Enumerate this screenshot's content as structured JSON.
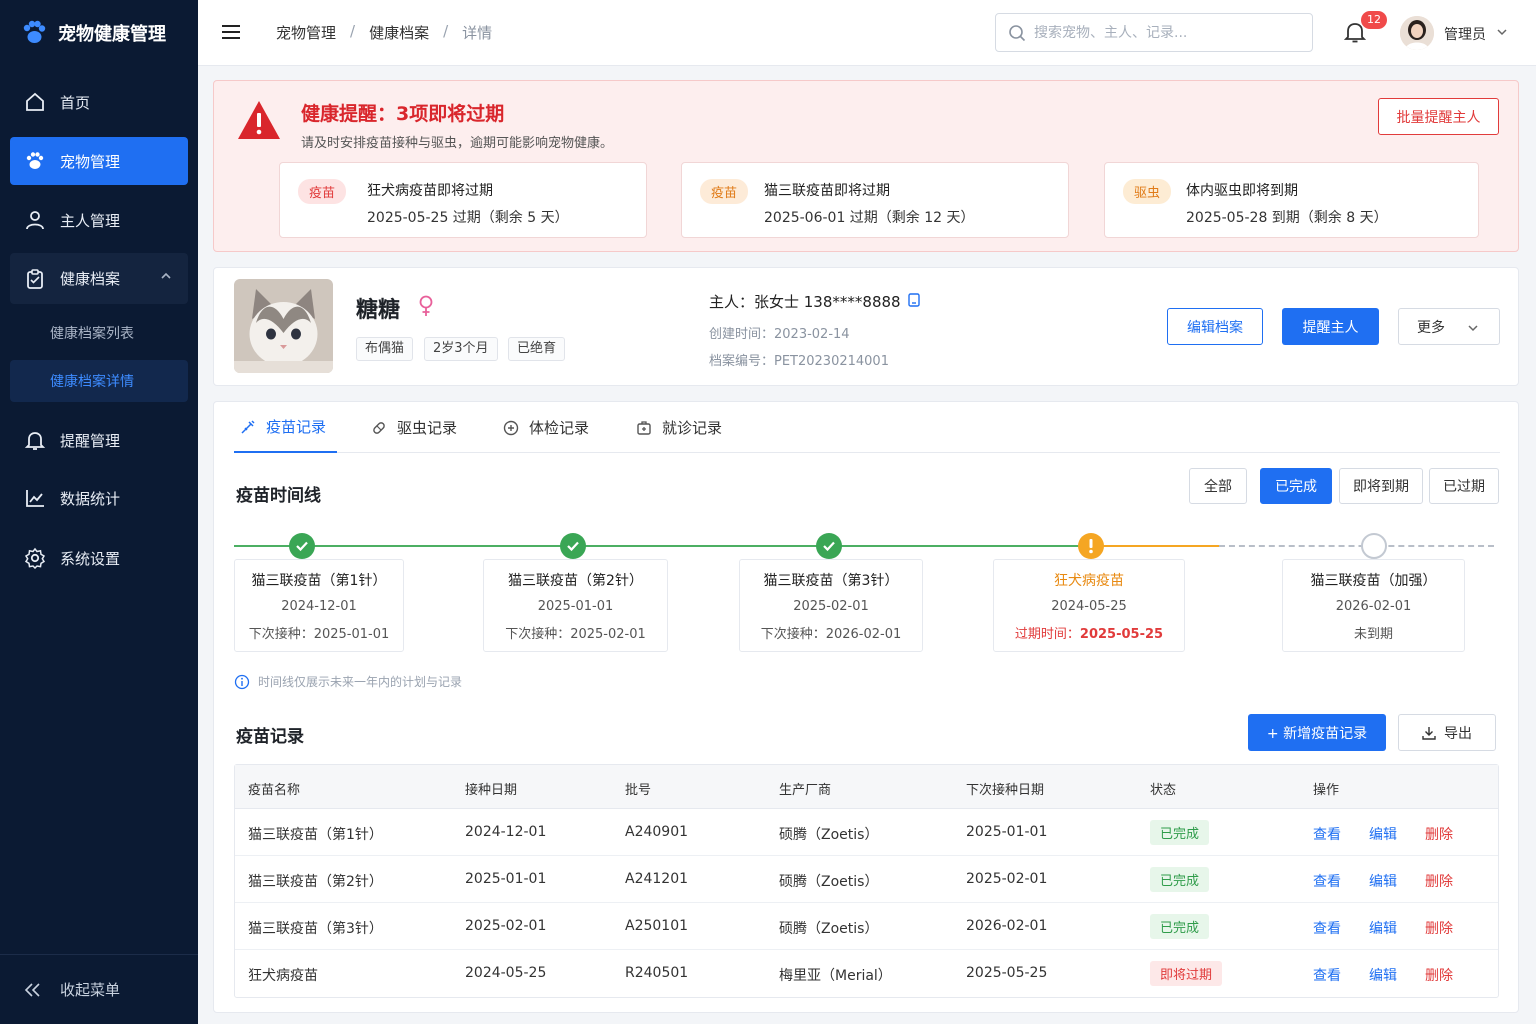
{
  "app": {
    "title": "宠物健康管理"
  },
  "sidebar": {
    "items": [
      {
        "label": "首页",
        "icon": "home-icon"
      },
      {
        "label": "宠物管理",
        "icon": "paw-icon"
      },
      {
        "label": "主人管理",
        "icon": "user-icon"
      },
      {
        "label": "健康档案",
        "icon": "clipboard-icon"
      },
      {
        "label": "提醒管理",
        "icon": "bell-icon"
      },
      {
        "label": "数据统计",
        "icon": "chart-icon"
      },
      {
        "label": "系统设置",
        "icon": "gear-icon"
      }
    ],
    "subitems": [
      {
        "label": "健康档案列表"
      },
      {
        "label": "健康档案详情"
      }
    ],
    "collapse_label": "收起菜单"
  },
  "topbar": {
    "breadcrumb": [
      "宠物管理",
      "健康档案",
      "详情"
    ],
    "search_placeholder": "搜索宠物、主人、记录...",
    "notification_count": "12",
    "user_name": "管理员"
  },
  "alert": {
    "title": "健康提醒：3项即将过期",
    "desc": "请及时安排疫苗接种与驱虫，逾期可能影响宠物健康。",
    "action": "批量提醒主人",
    "cards": [
      {
        "tag": "疫苗",
        "title": "狂犬病疫苗即将过期",
        "detail": "2025-05-25 过期（剩余 5 天）"
      },
      {
        "tag": "疫苗",
        "title": "猫三联疫苗即将过期",
        "detail": "2025-06-01 过期（剩余 12 天）"
      },
      {
        "tag": "驱虫",
        "title": "体内驱虫即将到期",
        "detail": "2025-05-28 到期（剩余 8 天）"
      }
    ]
  },
  "profile": {
    "name": "糖糖",
    "tags": [
      "布偶猫",
      "2岁3个月",
      "已绝育"
    ],
    "owner": "主人：张女士   138****8888",
    "created": "创建时间：2023-02-14",
    "record_no": "档案编号：PET20230214001",
    "buttons": {
      "edit": "编辑档案",
      "remind": "提醒主人",
      "more": "更多"
    }
  },
  "tabs": [
    "疫苗记录",
    "驱虫记录",
    "体检记录",
    "就诊记录"
  ],
  "timeline": {
    "title": "疫苗时间线",
    "filters": [
      "全部",
      "已完成",
      "即将到期",
      "已过期"
    ],
    "items": [
      {
        "name": "猫三联疫苗（第1针）",
        "date": "2024-12-01",
        "extra": "下次接种：2025-01-01"
      },
      {
        "name": "猫三联疫苗（第2针）",
        "date": "2025-01-01",
        "extra": "下次接种：2025-02-01"
      },
      {
        "name": "猫三联疫苗（第3针）",
        "date": "2025-02-01",
        "extra": "下次接种：2026-02-01"
      },
      {
        "name": "狂犬病疫苗",
        "date": "2024-05-25",
        "extra_label": "过期时间：",
        "extra_value": "2025-05-25"
      },
      {
        "name": "猫三联疫苗（加强）",
        "date": "2026-02-01",
        "extra": "未到期"
      }
    ],
    "note": "时间线仅展示未来一年内的计划与记录"
  },
  "records": {
    "title": "疫苗记录",
    "add_button": "+ 新增疫苗记录",
    "export_button": "导出",
    "columns": [
      "疫苗名称",
      "接种日期",
      "批号",
      "生产厂商",
      "下次接种日期",
      "状态",
      "操作"
    ],
    "rows": [
      {
        "name": "猫三联疫苗（第1针）",
        "date": "2024-12-01",
        "batch": "A240901",
        "maker": "硕腾（Zoetis）",
        "next": "2025-01-01",
        "status": "已完成"
      },
      {
        "name": "猫三联疫苗（第2针）",
        "date": "2025-01-01",
        "batch": "A241201",
        "maker": "硕腾（Zoetis）",
        "next": "2025-02-01",
        "status": "已完成"
      },
      {
        "name": "猫三联疫苗（第3针）",
        "date": "2025-02-01",
        "batch": "A250101",
        "maker": "硕腾（Zoetis）",
        "next": "2026-02-01",
        "status": "已完成"
      },
      {
        "name": "狂犬病疫苗",
        "date": "2024-05-25",
        "batch": "R240501",
        "maker": "梅里亚（Merial）",
        "next": "2025-05-25",
        "status": "即将过期"
      }
    ],
    "actions": {
      "view": "查看",
      "edit": "编辑",
      "delete": "删除"
    }
  },
  "colors": {
    "primary": "#1f6ff2",
    "sidebar": "#0b1a33",
    "danger": "#e13b3b",
    "success": "#2f9c4a",
    "warning": "#f5a623"
  }
}
